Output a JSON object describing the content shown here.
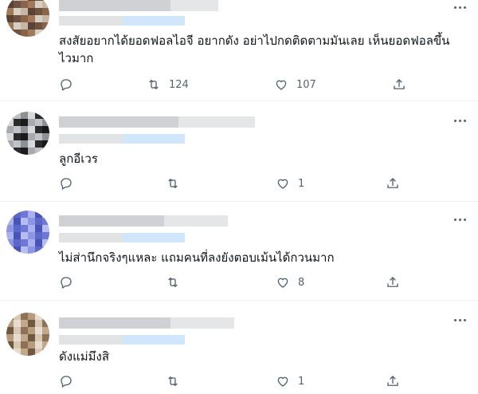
{
  "tweets": [
    {
      "text": "สงสัยอยากได้ยอดฟอลไอจี อยากดัง อย่าไปกดติดตามมันเลย เห็นยอดฟอลขึ้นไวมาก",
      "retweets": "124",
      "likes": "107",
      "avatar_colors": [
        "#a07a5a",
        "#8a6448",
        "#6f5240",
        "#5a4236",
        "#c6b6a2",
        "#d8cfc4"
      ]
    },
    {
      "text": "ลูกอีเวร",
      "retweets": "",
      "likes": "1",
      "avatar_colors": [
        "#bfc2c6",
        "#a7abb0",
        "#1a1a1a",
        "#2b2b2b",
        "#d7d9db",
        "#8d9196"
      ]
    },
    {
      "text": "ไม่ส่านึกจริงๆแหละ แถมคนที่ลงยังตอบเม้นได้กวนมาก",
      "retweets": "",
      "likes": "8",
      "avatar_colors": [
        "#6e79d6",
        "#5d68c9",
        "#8d96e4",
        "#b7bdf0",
        "#4954b7",
        "#aab1ef"
      ]
    },
    {
      "text": "ดังแม่มึงสิ",
      "retweets": "",
      "likes": "1",
      "avatar_colors": [
        "#b89a7c",
        "#8d7258",
        "#d9c7b2",
        "#6f5842",
        "#c0a888",
        "#e6dccf"
      ]
    }
  ],
  "icons": {
    "reply": "reply-icon",
    "retweet": "retweet-icon",
    "like": "heart-icon",
    "share": "share-icon",
    "more": "more-icon"
  },
  "colors": {
    "text": "#0f1419",
    "secondary": "#536471",
    "divider": "#eff3f4",
    "blur_gray": "#d5d7da",
    "blur_blue": "#cfe6fb"
  }
}
